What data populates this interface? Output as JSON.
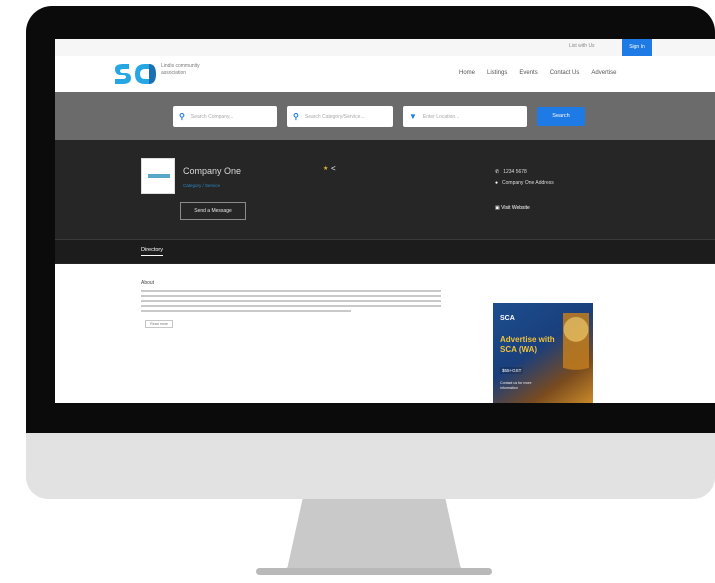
{
  "topbar": {
    "register_link": "List with Us",
    "signin_label": "Sign In"
  },
  "header": {
    "logo_text": "Lindis community association",
    "nav": [
      "Home",
      "Listings",
      "Events",
      "Contact Us",
      "Advertise"
    ]
  },
  "search": {
    "company_placeholder": "Search Company...",
    "category_placeholder": "Search Category/Service...",
    "location_placeholder": "Enter Location...",
    "button_label": "Search"
  },
  "company": {
    "name": "Company One",
    "subtitle": "Category / Service",
    "send_message_label": "Send a Message",
    "phone": "1234 5678",
    "address": "Company One Address",
    "website_label": "Visit Website"
  },
  "tabs": {
    "active": "Directory"
  },
  "about": {
    "title": "About",
    "more_label": "Read more"
  },
  "ad": {
    "logo": "SCA",
    "headline": "Advertise with SCA (WA)",
    "price": "$55+GST",
    "subtext": "Contact us for more information"
  },
  "colors": {
    "accent": "#1e7be6",
    "dark_band": "#262626",
    "search_band": "#6b6b6b"
  }
}
